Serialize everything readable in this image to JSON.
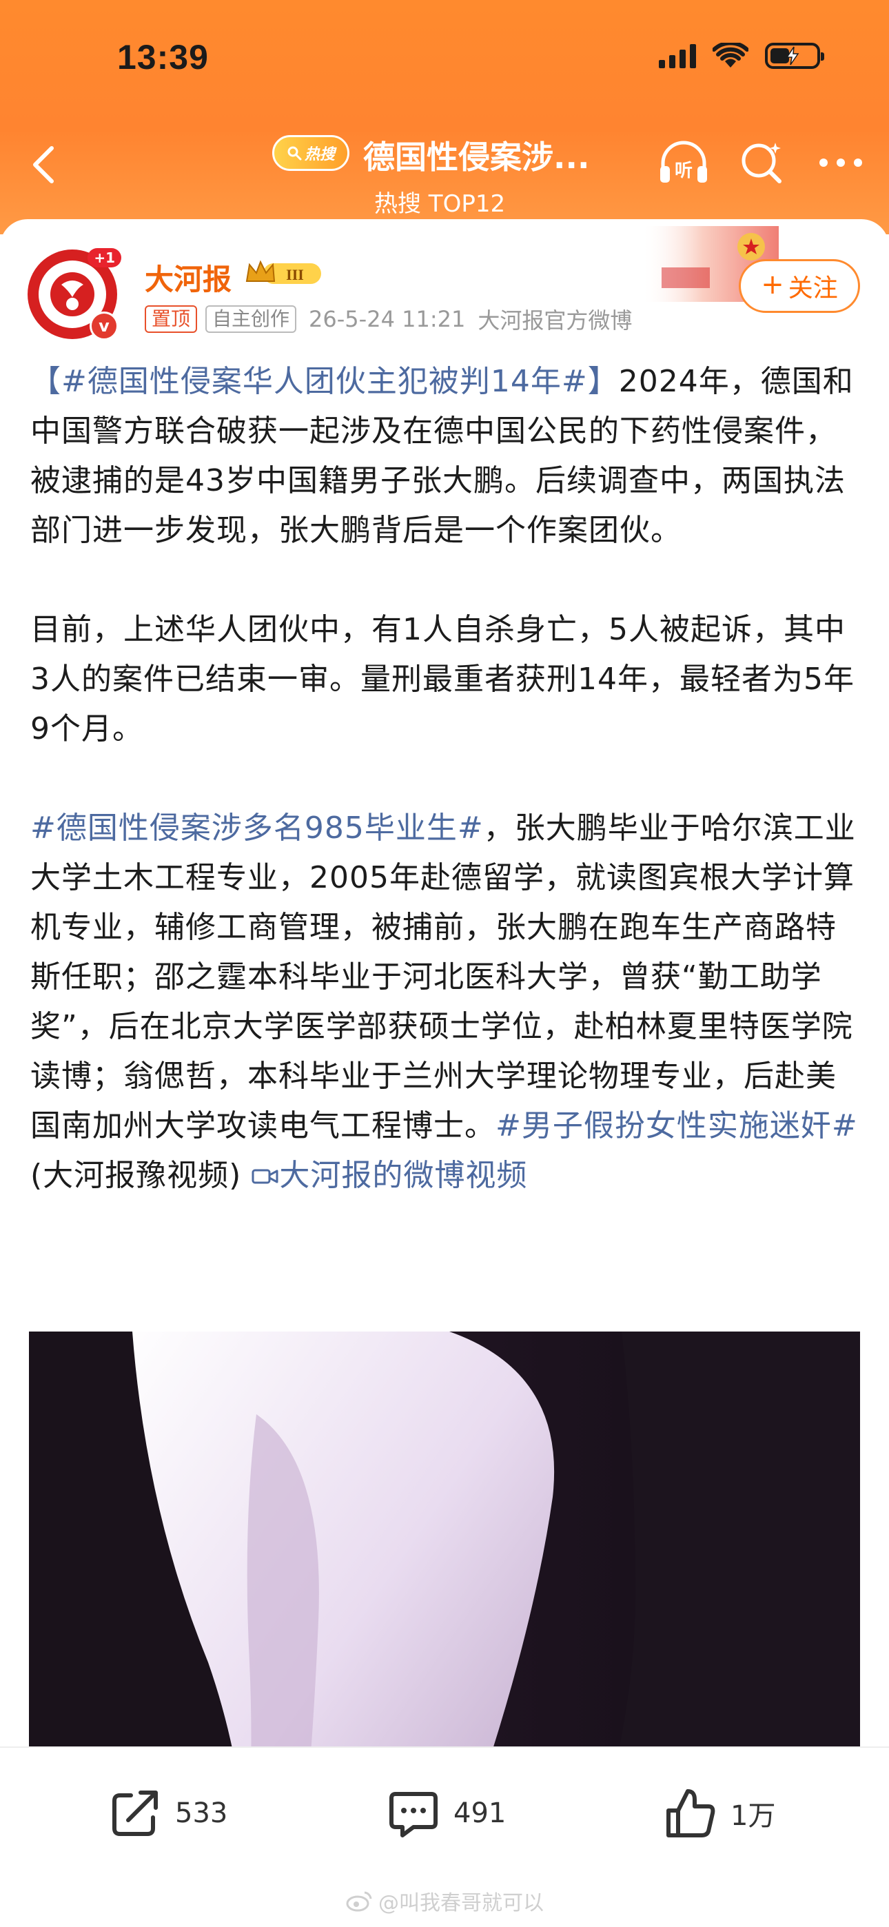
{
  "status_bar": {
    "time": "13:39"
  },
  "nav": {
    "hot_badge": "热搜",
    "title": "德国性侵案涉...",
    "subtitle": "热搜 TOP12",
    "listen_label": "听"
  },
  "author": {
    "name": "大河报",
    "avatar_badge": "+1",
    "verified_mark": "v",
    "vip_level": "III",
    "pin_tag": "置顶",
    "original_tag": "自主创作",
    "time": "26-5-24 11:21",
    "source": "大河报官方微博",
    "follow_label": "关注"
  },
  "post": {
    "p1_tag": "【#德国性侵案华人团伙主犯被判14年#】",
    "p1_text": "2024年，德国和中国警方联合破获一起涉及在德中国公民的下药性侵案件，被逮捕的是43岁中国籍男子张大鹏。后续调查中，两国执法部门进一步发现，张大鹏背后是一个作案团伙。",
    "p2_text": "目前，上述华人团伙中，有1人自杀身亡，5人被起诉，其中3人的案件已结束一审。量刑最重者获刑14年，最轻者为5年9个月。",
    "p3_tag": "#德国性侵案涉多名985毕业生#",
    "p3_text": "，张大鹏毕业于哈尔滨工业大学土木工程专业，2005年赴德留学，就读图宾根大学计算机专业，辅修工商管理，被捕前，张大鹏在跑车生产商路特斯任职；邵之霆本科毕业于河北医科大学，曾获“勤工助学奖”，后在北京大学医学部获硕士学位，赴柏林夏里特医学院读博；翁偲哲，本科毕业于兰州大学理论物理专业，后赴美国南加州大学攻读电气工程博士。",
    "p3_tag2": "#男子假扮女性实施迷奸#",
    "p3_tail": "(大河报豫视频)",
    "video_link": "大河报的微博视频"
  },
  "actions": {
    "share_count": "533",
    "comment_count": "491",
    "like_count": "1万"
  },
  "watermark": "@叫我春哥就可以",
  "colors": {
    "header_orange": "#ff8a2e",
    "link_blue": "#4d6aa0",
    "author_orange": "#f0640a"
  }
}
